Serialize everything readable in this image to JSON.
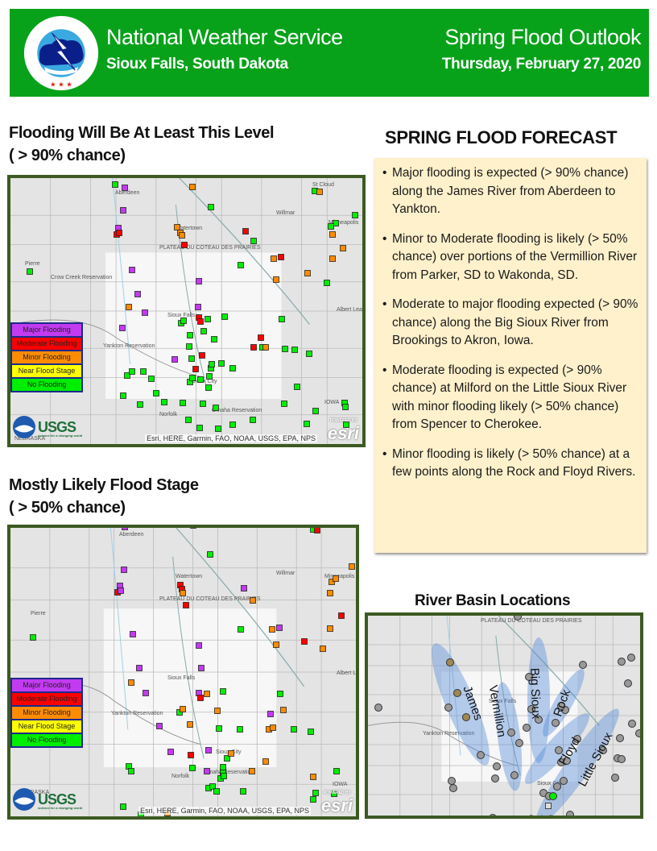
{
  "header": {
    "organization": "National Weather Service",
    "location": "Sioux Falls, South Dakota",
    "product_title": "Spring Flood Outlook",
    "date": "Thursday, February 27, 2020",
    "logo_icon": "nws-logo-icon",
    "logo_text": "NATIONAL WEATHER SERVICE",
    "banner_color": "#07a21a"
  },
  "map_90": {
    "title_line1": "Flooding Will Be At Least This Level",
    "title_line2": "( > 90% chance)",
    "place_labels": [
      "Aberdeen",
      "St Cloud",
      "Willmar",
      "Minneapolis",
      "Watertown",
      "Pierre",
      "Crow Creek Reservation",
      "Sioux Falls",
      "Albert Lea",
      "Yankton Reservation",
      "Sioux City",
      "Norfolk",
      "Omaha Reservation",
      "IOWA",
      "NEBRASKA",
      "PLATEAU DU COTEAU DES PRAIRIES"
    ]
  },
  "map_50": {
    "title_line1": "Mostly Likely Flood Stage",
    "title_line2": "( > 50% chance)"
  },
  "legend": [
    {
      "label": "Major Flooding",
      "color": "#c23bf0"
    },
    {
      "label": "Moderate Flooding",
      "color": "#ff0000"
    },
    {
      "label": "Minor Flooding",
      "color": "#ff8c00"
    },
    {
      "label": "Near Flood Stage",
      "color": "#ffff00"
    },
    {
      "label": "No Flooding",
      "color": "#00ee00"
    }
  ],
  "map_credits": {
    "attribution": "Esri, HERE, Garmin, FAO, NOAA, USGS, EPA, NPS",
    "esri_logo": "esri",
    "esri_powered": "POWERED BY",
    "noaa_logo": "noaa-logo-icon",
    "usgs_logo": "USGS",
    "usgs_tagline": "science for a changing world"
  },
  "forecast": {
    "title": "SPRING FLOOD FORECAST",
    "items": [
      "Major flooding is expected (> 90% chance) along the James River from Aberdeen to Yankton.",
      "Minor to Moderate flooding is likely (> 50% chance) over portions of the Vermillion River from Parker, SD to Wakonda, SD.",
      "Moderate to major flooding expected (> 90% chance) along the Big Sioux River from Brookings to Akron, Iowa.",
      "Moderate flooding is expected (> 90% chance) at Milford on the Little Sioux River with minor flooding likely (> 50% chance) from Spencer to Cherokee.",
      "Minor flooding is likely (> 50% chance) at a few points along the Rock and Floyd Rivers."
    ],
    "box_color": "#fff1cc"
  },
  "basins": {
    "title": "River Basin Locations",
    "labels": [
      "James",
      "Vermillion",
      "Big Sioux",
      "Rock",
      "Floyd",
      "Little Sioux"
    ]
  }
}
